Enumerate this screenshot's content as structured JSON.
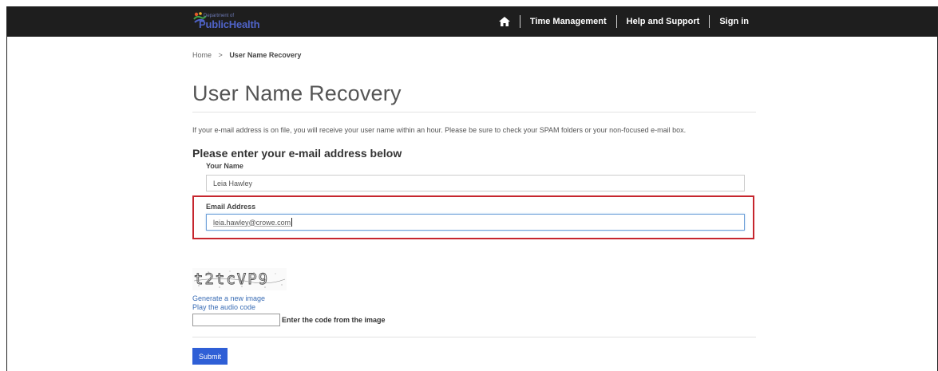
{
  "colors": {
    "topbar": "#1e1e1e",
    "accent": "#2f5fd6",
    "highlight_border": "#c6262e",
    "link": "#3a6db5"
  },
  "header": {
    "logo_small_text": "Department of",
    "logo_name": "PublicHealth",
    "home_icon": "home-icon",
    "nav": [
      {
        "label": "Time Management"
      },
      {
        "label": "Help and Support"
      },
      {
        "label": "Sign in"
      }
    ]
  },
  "breadcrumb": {
    "home": "Home",
    "separator": ">",
    "current": "User Name Recovery"
  },
  "page": {
    "title": "User Name Recovery",
    "info": "If your e-mail address is on file, you will receive your user name within an hour. Please be sure to check your SPAM folders or your non-focused e-mail box.",
    "subheading": "Please enter your e-mail address below"
  },
  "form": {
    "name_label": "Your Name",
    "name_value": "Leia Hawley",
    "email_label": "Email Address",
    "email_value": "leia.hawley@crowe.com"
  },
  "captcha": {
    "image_text": "t2tcVP9",
    "generate_link": "Generate a new image",
    "audio_link": "Play the audio code",
    "code_value": "",
    "code_label": "Enter the code from the image"
  },
  "submit_label": "Submit"
}
